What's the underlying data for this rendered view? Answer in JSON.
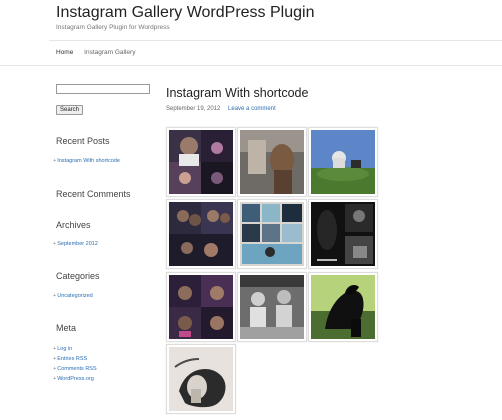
{
  "site": {
    "title": "Instagram Gallery WordPress Plugin",
    "description": "Instagram Gallery Plugin for Wordpress"
  },
  "nav": {
    "items": [
      "Home",
      "Instagram Gallery"
    ]
  },
  "sidebar": {
    "search": {
      "button_label": "Search",
      "value": ""
    },
    "recent_posts": {
      "title": "Recent Posts",
      "items": [
        "Instagram With shortcode"
      ]
    },
    "recent_comments": {
      "title": "Recent Comments"
    },
    "archives": {
      "title": "Archives",
      "items": [
        "September 2012"
      ]
    },
    "categories": {
      "title": "Categories",
      "items": [
        "Uncategorized"
      ]
    },
    "meta": {
      "title": "Meta",
      "items": [
        "Log in",
        "Entries RSS",
        "Comments RSS",
        "WordPress.org"
      ]
    }
  },
  "post": {
    "title": "Instagram With shortcode",
    "date": "September 19, 2012",
    "comment_link": "Leave a comment"
  },
  "gallery": {
    "count": 10
  }
}
